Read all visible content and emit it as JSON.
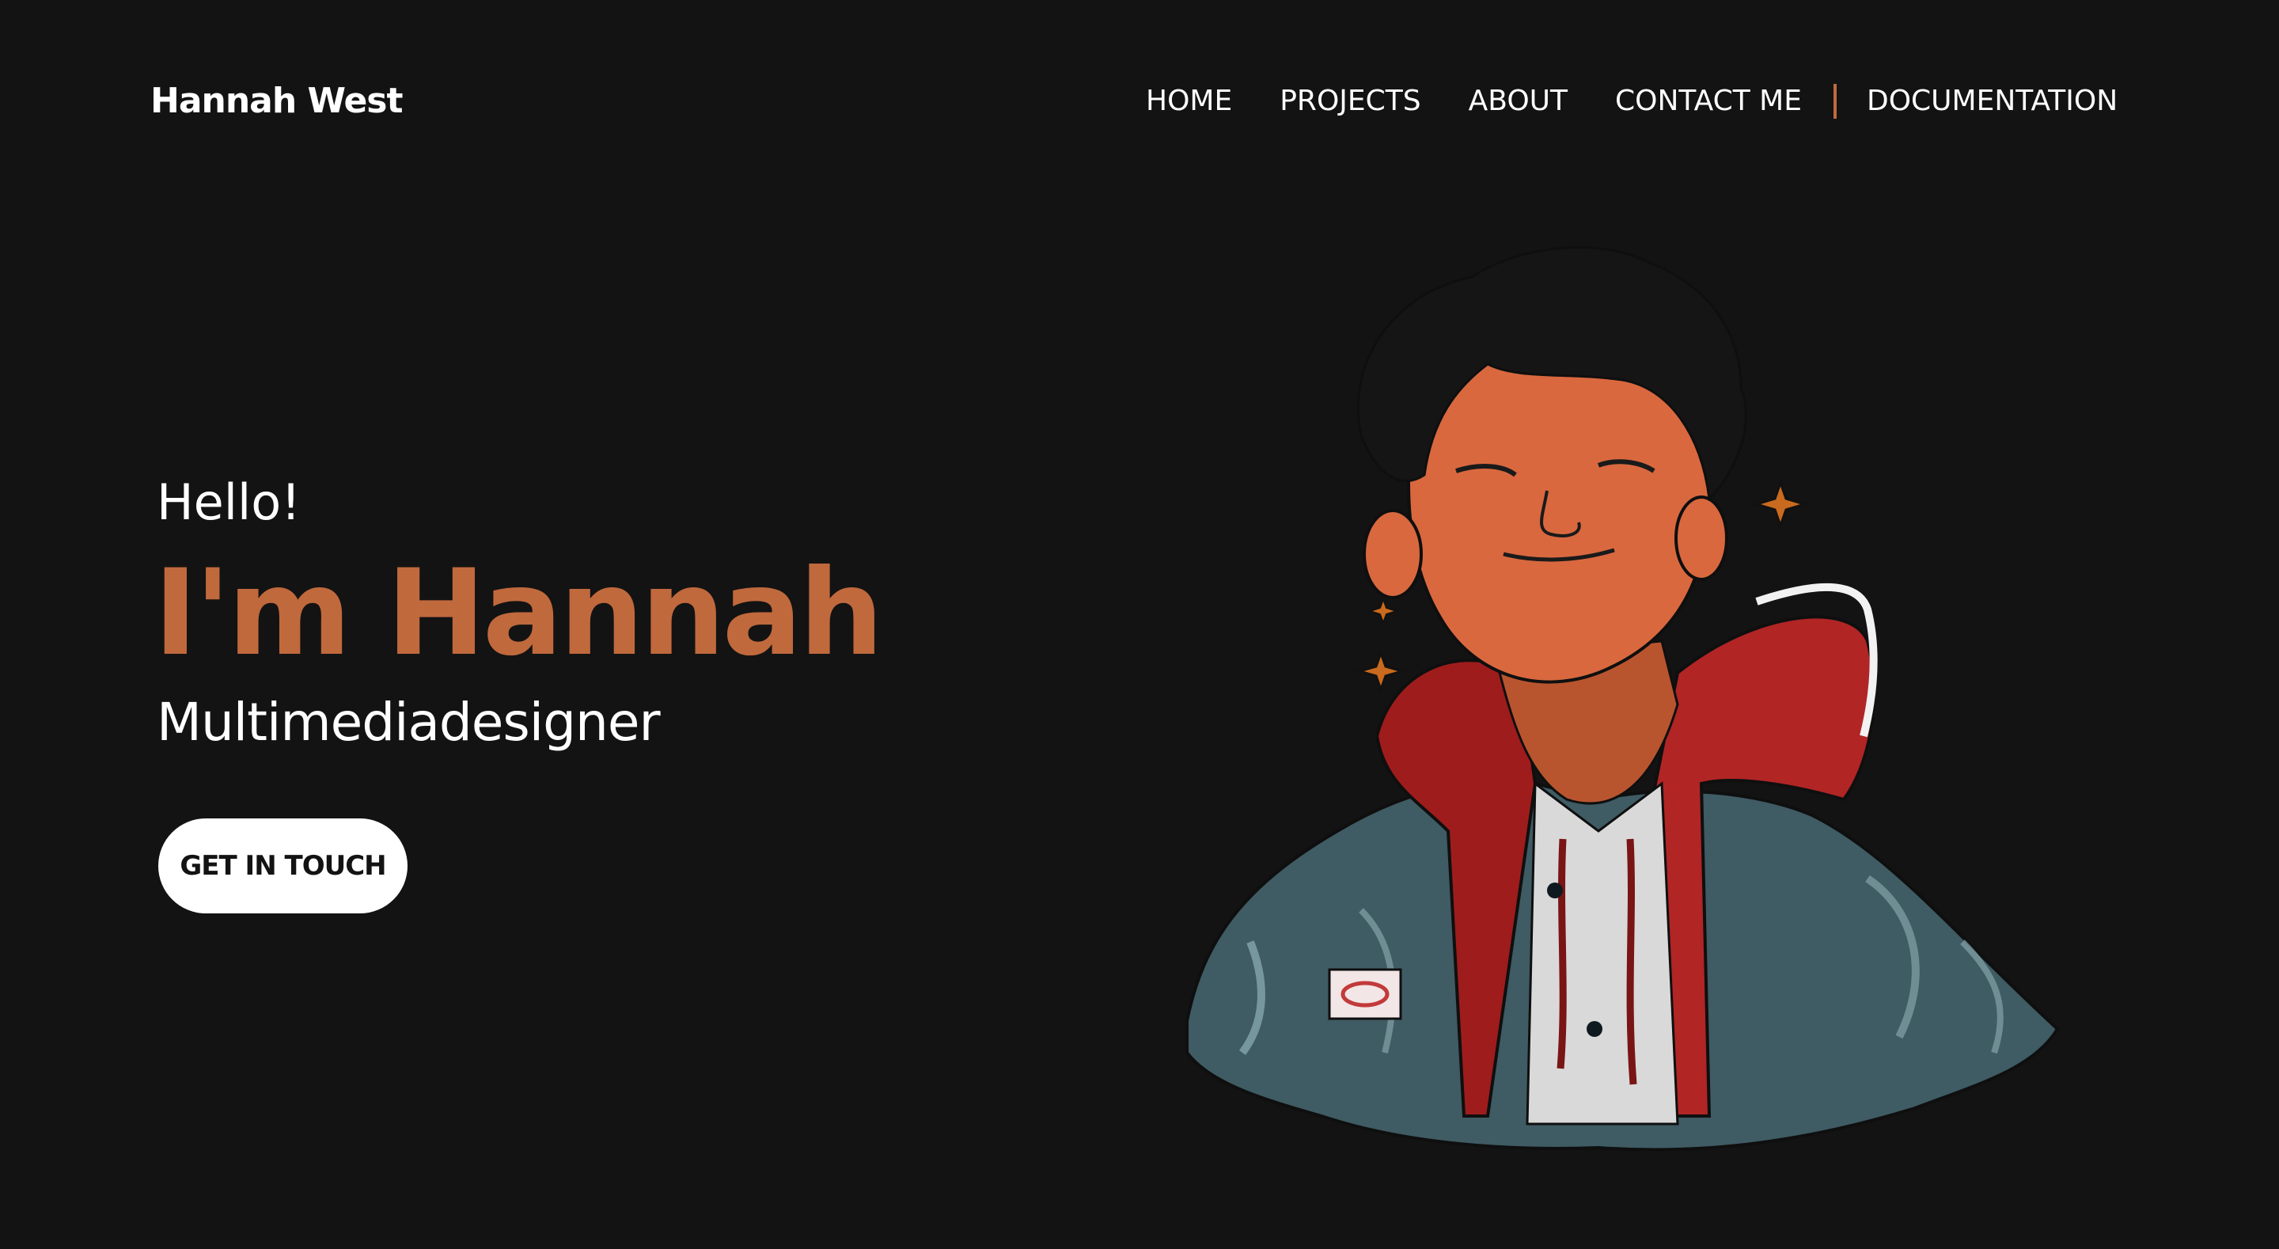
{
  "header": {
    "brand": "Hannah West",
    "nav": [
      {
        "label": "HOME"
      },
      {
        "label": "PROJECTS"
      },
      {
        "label": "ABOUT"
      },
      {
        "label": "CONTACT ME"
      },
      {
        "label": "DOCUMENTATION"
      }
    ]
  },
  "hero": {
    "greeting": "Hello!",
    "headline": "I'm Hannah",
    "role": "Multimediadesigner",
    "cta_label": "GET IN TOUCH"
  },
  "illustration": {
    "subject": "portrait-illustration",
    "icon": "person-portrait-illustration"
  },
  "colors": {
    "background": "#131313",
    "accent": "#c0693d",
    "text": "#ffffff",
    "button_bg": "#ffffff",
    "button_text": "#131313"
  }
}
